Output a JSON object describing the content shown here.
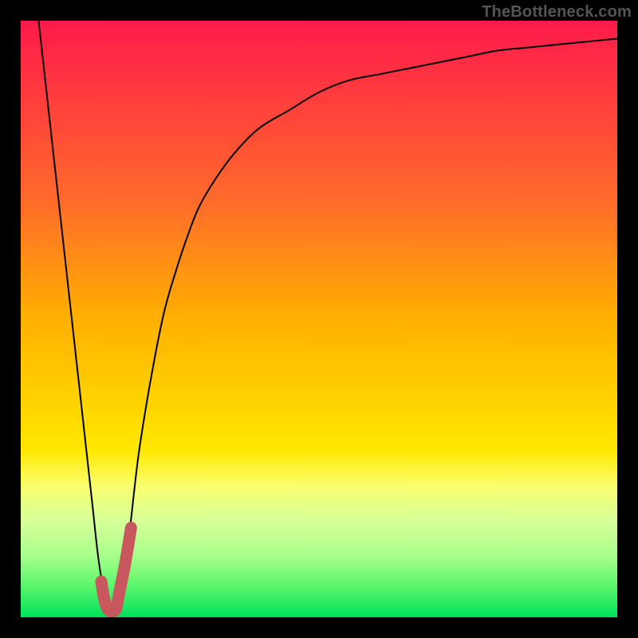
{
  "attribution": "TheBottleneck.com",
  "chart_data": {
    "type": "line",
    "title": "",
    "xlabel": "",
    "ylabel": "",
    "xlim": [
      0,
      100
    ],
    "ylim": [
      0,
      100
    ],
    "gradient_stops": [
      {
        "offset": 0,
        "color": "#ff1a4b"
      },
      {
        "offset": 30,
        "color": "#ff6a2b"
      },
      {
        "offset": 50,
        "color": "#ffb000"
      },
      {
        "offset": 72,
        "color": "#ffe800"
      },
      {
        "offset": 78,
        "color": "#faff6e"
      },
      {
        "offset": 84,
        "color": "#d6ff9a"
      },
      {
        "offset": 90,
        "color": "#a4ff8a"
      },
      {
        "offset": 95,
        "color": "#56f56a"
      },
      {
        "offset": 100,
        "color": "#00e05c"
      }
    ],
    "series": [
      {
        "name": "bottleneck-curve",
        "stroke": "#000000",
        "stroke_width": 2,
        "x": [
          3,
          4,
          5,
          6,
          7,
          8,
          9,
          10,
          11,
          12,
          13,
          14,
          15,
          16,
          17,
          18,
          19,
          20,
          22,
          24,
          26,
          28,
          30,
          33,
          36,
          40,
          45,
          50,
          55,
          60,
          65,
          70,
          75,
          80,
          85,
          90,
          95,
          100
        ],
        "values": [
          100,
          91,
          82,
          73,
          64,
          55,
          46,
          37,
          28,
          19,
          10,
          4,
          1,
          1,
          4,
          12,
          21,
          29,
          41,
          51,
          58,
          64,
          69,
          74,
          78,
          82,
          85,
          88,
          90,
          91,
          92,
          93,
          94,
          95,
          95.5,
          96,
          96.5,
          97
        ]
      },
      {
        "name": "optimal-marker",
        "stroke": "#c9575e",
        "stroke_width": 15,
        "linecap": "round",
        "x": [
          13.5,
          14.0,
          14.5,
          15.0,
          15.5,
          16.0,
          16.5,
          17.5,
          18.5
        ],
        "values": [
          6.0,
          3.0,
          1.5,
          1.0,
          1.0,
          1.5,
          4.0,
          9.0,
          15.0
        ]
      }
    ]
  }
}
